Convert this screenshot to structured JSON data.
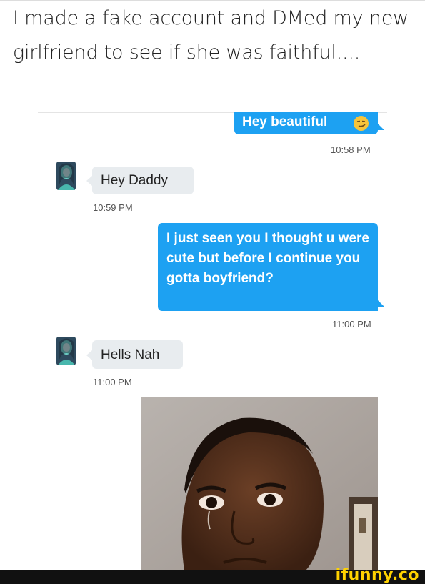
{
  "caption": "I made a fake account and DMed my new girlfriend to see if she was faithful....",
  "messages": [
    {
      "side": "out",
      "text": "Hey beautiful",
      "time": "10:58 PM"
    },
    {
      "side": "in",
      "text": "Hey Daddy",
      "time": "10:59 PM"
    },
    {
      "side": "out",
      "text": "I just seen you I thought u were cute but before I continue you gotta boyfriend?",
      "time": "11:00 PM"
    },
    {
      "side": "in",
      "text": "Hells Nah",
      "time": "11:00 PM"
    }
  ],
  "icons": {
    "emoji": "smirk-emoji-icon",
    "avatar": "profile-avatar-icon"
  },
  "colors": {
    "outgoing": "#1da1f2",
    "incoming": "#e8ecef",
    "brand": "#ffd200"
  },
  "watermark": "ifunny.co"
}
